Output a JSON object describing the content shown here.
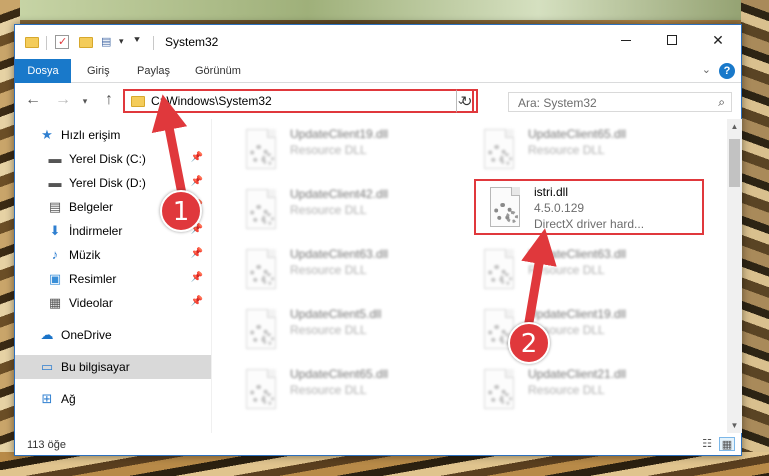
{
  "titlebar": {
    "title": "System32",
    "minimize_icon": "minimize-icon",
    "maximize_icon": "maximize-icon",
    "close_icon": "close-icon"
  },
  "ribbon": {
    "tabs": [
      {
        "label": "Dosya"
      },
      {
        "label": "Giriş"
      },
      {
        "label": "Paylaş"
      },
      {
        "label": "Görünüm"
      }
    ],
    "help": "?"
  },
  "nav": {
    "address": "C:\\Windows\\System32",
    "refresh_icon": "↻",
    "search_placeholder": "Ara: System32"
  },
  "sidebar": {
    "items": [
      {
        "label": "Hızlı erişim",
        "icon": "star-icon"
      },
      {
        "label": "Yerel Disk (C:)",
        "icon": "drive-icon"
      },
      {
        "label": "Yerel Disk (D:)",
        "icon": "drive-icon"
      },
      {
        "label": "Belgeler",
        "icon": "documents-icon"
      },
      {
        "label": "İndirmeler",
        "icon": "download-icon"
      },
      {
        "label": "Müzik",
        "icon": "music-icon"
      },
      {
        "label": "Resimler",
        "icon": "pictures-icon"
      },
      {
        "label": "Videolar",
        "icon": "videos-icon"
      },
      {
        "label": "OneDrive",
        "icon": "cloud-icon"
      },
      {
        "label": "Bu bilgisayar",
        "icon": "computer-icon"
      },
      {
        "label": "Ağ",
        "icon": "network-icon"
      }
    ]
  },
  "files": [
    {
      "name": "UpdateClient19.dll",
      "line1": "Resource DLL",
      "line2": ""
    },
    {
      "name": "UpdateClient65.dll",
      "line1": "Resource DLL",
      "line2": ""
    },
    {
      "name": "UpdateClient42.dll",
      "line1": "Resource DLL",
      "line2": ""
    },
    {
      "name": "istri.dll",
      "line1": "4.5.0.129",
      "line2": "DirectX driver hard..."
    },
    {
      "name": "UpdateClient63.dll",
      "line1": "Resource DLL",
      "line2": ""
    },
    {
      "name": "UpdateClient63.dll",
      "line1": "Resource DLL",
      "line2": ""
    },
    {
      "name": "UpdateClient5.dll",
      "line1": "Resource DLL",
      "line2": ""
    },
    {
      "name": "UpdateClient19.dll",
      "line1": "Resource DLL",
      "line2": ""
    },
    {
      "name": "UpdateClient65.dll",
      "line1": "Resource DLL",
      "line2": ""
    },
    {
      "name": "UpdateClient21.dll",
      "line1": "Resource DLL",
      "line2": ""
    }
  ],
  "status": {
    "count": "113 öğe"
  },
  "annotations": {
    "badge1": "1",
    "badge2": "2",
    "color": "#e0383c"
  }
}
